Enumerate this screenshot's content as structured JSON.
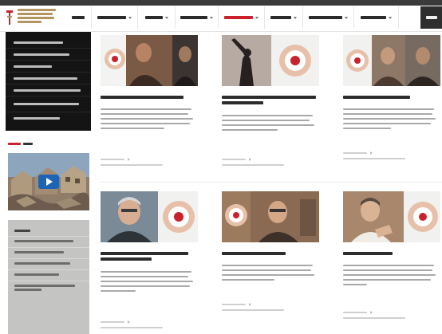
{
  "header": {
    "logo_lines": [
      "",
      "",
      "",
      ""
    ],
    "nav": [
      {
        "label": "",
        "has_dropdown": false,
        "active": false
      },
      {
        "label": "",
        "has_dropdown": true,
        "active": false
      },
      {
        "label": "",
        "has_dropdown": true,
        "active": false
      },
      {
        "label": "",
        "has_dropdown": true,
        "active": false
      },
      {
        "label": "",
        "has_dropdown": true,
        "active": true
      },
      {
        "label": "",
        "has_dropdown": true,
        "active": false
      },
      {
        "label": "",
        "has_dropdown": true,
        "active": false
      },
      {
        "label": "",
        "has_dropdown": true,
        "active": false
      }
    ],
    "login_label": ""
  },
  "sidebar": {
    "menu": [
      "",
      "",
      "",
      "",
      "",
      "",
      "",
      ""
    ],
    "video": {
      "heading_accent": "",
      "heading_rest": "",
      "icon": "play-icon"
    },
    "links": {
      "title": "",
      "items": [
        "",
        "",
        "",
        "",
        ""
      ]
    }
  },
  "articles": [
    {
      "title": "",
      "excerpt": "",
      "date": "",
      "footer": ""
    },
    {
      "title": "",
      "excerpt": "",
      "date": "",
      "footer": ""
    },
    {
      "title": "",
      "excerpt": "",
      "date": "",
      "footer": ""
    },
    {
      "title": "",
      "excerpt": "",
      "date": "",
      "footer": ""
    },
    {
      "title": "",
      "excerpt": "",
      "date": "",
      "footer": ""
    },
    {
      "title": "",
      "excerpt": "",
      "date": "",
      "footer": ""
    }
  ],
  "colors": {
    "accent": "#c9222c",
    "brand": "#b3935e",
    "dark": "#141414"
  }
}
